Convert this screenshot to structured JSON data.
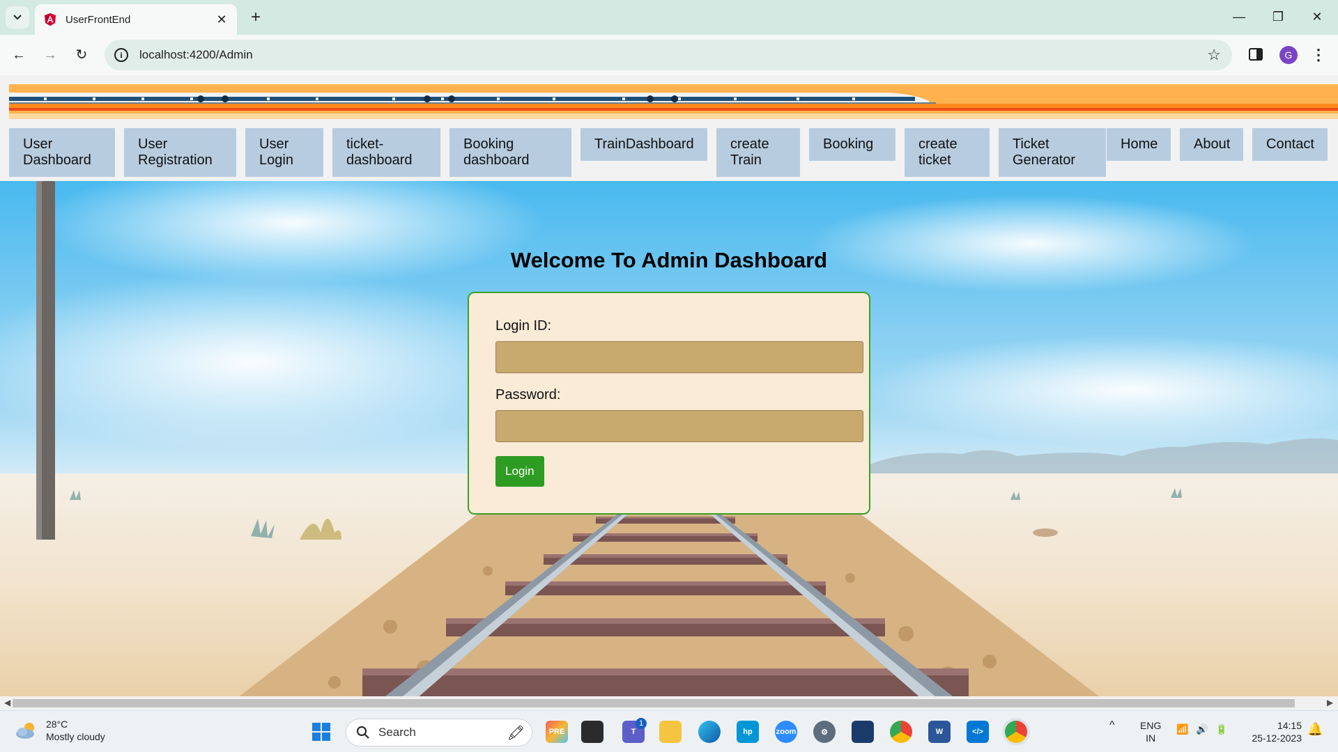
{
  "browser": {
    "tab_title": "UserFrontEnd",
    "url": "localhost:4200/Admin",
    "profile_initial": "G"
  },
  "nav": {
    "items": [
      {
        "label": "User\nDashboard"
      },
      {
        "label": "User\nRegistration"
      },
      {
        "label": "User\nLogin"
      },
      {
        "label": "ticket-\ndashboard"
      },
      {
        "label": "Booking\ndashboard"
      },
      {
        "label": "TrainDashboard"
      },
      {
        "label": "create\nTrain"
      },
      {
        "label": "Booking"
      },
      {
        "label": "create\nticket"
      },
      {
        "label": "Ticket\nGenerator"
      },
      {
        "label": "Home"
      },
      {
        "label": "About"
      },
      {
        "label": "Contact"
      }
    ]
  },
  "main": {
    "heading": "Welcome To Admin Dashboard",
    "login_id_label": "Login ID:",
    "password_label": "Password:",
    "login_button": "Login"
  },
  "taskbar": {
    "temperature": "28°C",
    "weather": "Mostly cloudy",
    "search_placeholder": "Search",
    "teams_badge": "1",
    "lang_line1": "ENG",
    "lang_line2": "IN",
    "time": "14:15",
    "date": "25-12-2023"
  },
  "colors": {
    "nav_bg": "#b8cce0",
    "card_bg": "#faebd7",
    "card_border": "#3aa028",
    "input_bg": "#c8aa6e",
    "button_bg": "#2e9c22"
  }
}
